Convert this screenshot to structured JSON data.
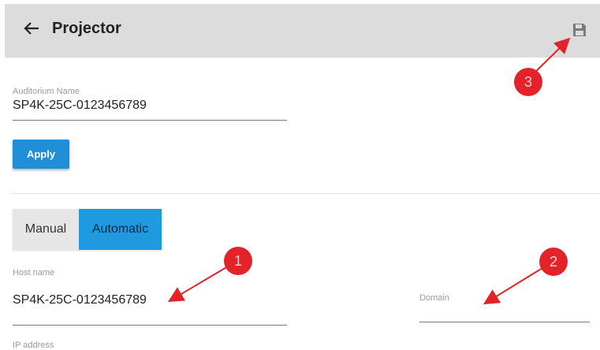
{
  "header": {
    "title": "Projector",
    "back_icon": "arrow-left-icon",
    "save_icon": "floppy-disk-icon"
  },
  "auditorium": {
    "label": "Auditorium Name",
    "value": "SP4K-25C-0123456789"
  },
  "apply_label": "Apply",
  "mode_toggle": {
    "options": [
      "Manual",
      "Automatic"
    ],
    "selected": "Automatic"
  },
  "host": {
    "label": "Host name",
    "value": "SP4K-25C-0123456789"
  },
  "domain": {
    "label": "Domain",
    "value": ""
  },
  "ip": {
    "label": "IP address"
  },
  "callouts": [
    "1",
    "2",
    "3"
  ],
  "colors": {
    "accent": "#1f9ae0",
    "callout": "#e2232a",
    "header_bg": "#dcdcdc"
  }
}
